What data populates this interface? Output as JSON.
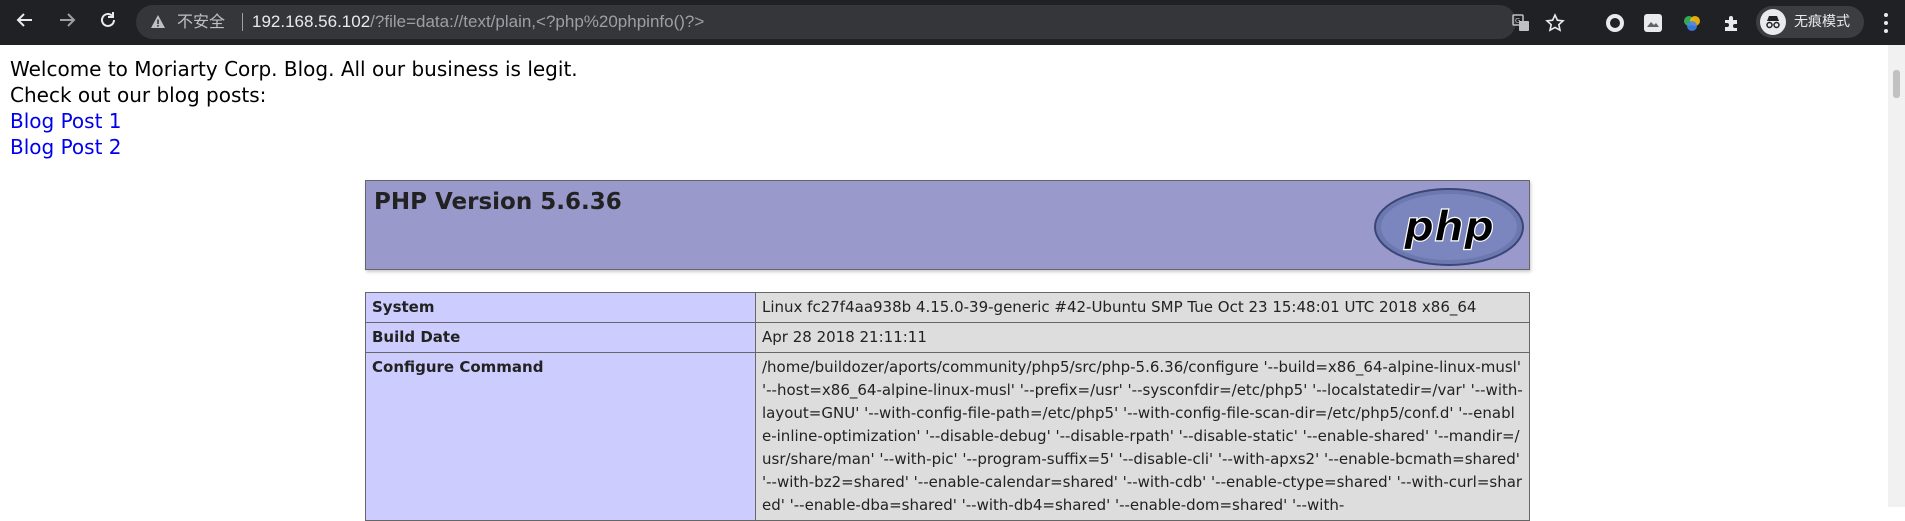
{
  "browser": {
    "insecure_label": "不安全",
    "url_host": "192.168.56.102",
    "url_path": "/?file=data://text/plain,<?php%20phpinfo()?>",
    "incognito_label": "无痕模式",
    "icons": [
      "back-arrow-icon",
      "forward-arrow-icon",
      "reload-icon",
      "warning-icon",
      "translate-icon",
      "bookmark-star-icon",
      "extension-circle-icon",
      "extension-image-icon",
      "extension-color-icon",
      "extensions-puzzle-icon",
      "incognito-icon",
      "menu-dots-icon"
    ]
  },
  "blog": {
    "welcome": "Welcome to Moriarty Corp. Blog. All our business is legit.",
    "checkout": "Check out our blog posts:",
    "links": [
      "Blog Post 1",
      "Blog Post 2"
    ],
    "link_color": "#0000ee"
  },
  "phpinfo": {
    "title": "PHP Version 5.6.36",
    "logo_text": "php",
    "header_bg": "#9999cc",
    "rows": [
      {
        "key": "System",
        "value": "Linux fc27f4aa938b 4.15.0-39-generic #42-Ubuntu SMP Tue Oct 23 15:48:01 UTC 2018 x86_64"
      },
      {
        "key": "Build Date",
        "value": "Apr 28 2018 21:11:11"
      },
      {
        "key": "Configure Command",
        "value": "/home/buildozer/aports/community/php5/src/php-5.6.36/configure '--build=x86_64-alpine-linux-musl' '--host=x86_64-alpine-linux-musl' '--prefix=/usr' '--sysconfdir=/etc/php5' '--localstatedir=/var' '--with-layout=GNU' '--with-config-file-path=/etc/php5' '--with-config-file-scan-dir=/etc/php5/conf.d' '--enable-inline-optimization' '--disable-debug' '--disable-rpath' '--disable-static' '--enable-shared' '--mandir=/usr/share/man' '--with-pic' '--program-suffix=5' '--disable-cli' '--with-apxs2' '--enable-bcmath=shared' '--with-bz2=shared' '--enable-calendar=shared' '--with-cdb' '--enable-ctype=shared' '--with-curl=shared' '--enable-dba=shared' '--with-db4=shared' '--enable-dom=shared' '--with-"
      }
    ]
  }
}
